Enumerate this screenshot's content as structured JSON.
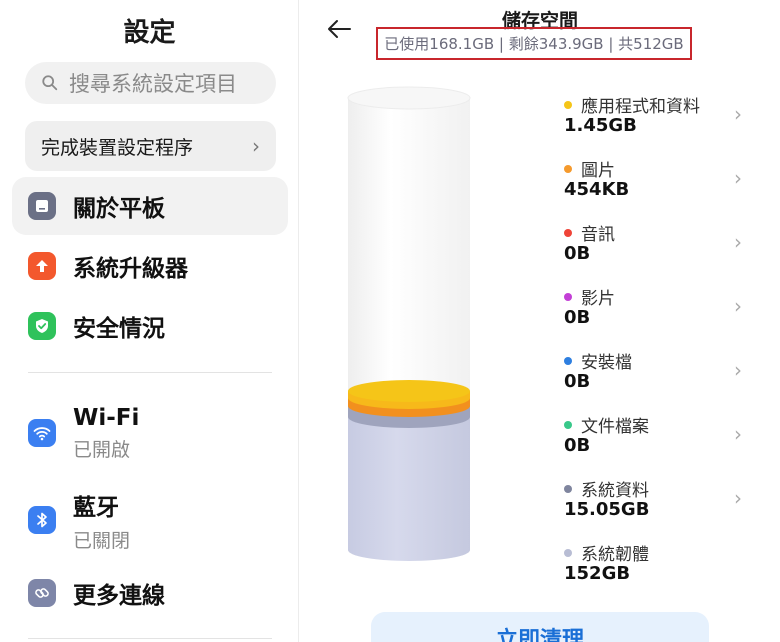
{
  "settings": {
    "title": "設定",
    "search_placeholder": "搜尋系統設定項目",
    "setup_card": {
      "label": "完成裝置設定程序"
    },
    "menu": [
      {
        "label": "關於平板",
        "icon": "tablet-icon",
        "color": "#6b7086"
      },
      {
        "label": "系統升級器",
        "icon": "arrow-up-icon",
        "color": "#f3582d"
      },
      {
        "label": "安全情況",
        "icon": "shield-check-icon",
        "color": "#2fc25b"
      },
      {
        "label": "Wi-Fi",
        "sub": "已開啟",
        "icon": "wifi-icon",
        "color": "#3b7ff1"
      },
      {
        "label": "藍牙",
        "sub": "已關閉",
        "icon": "bluetooth-icon",
        "color": "#3b7ff1"
      },
      {
        "label": "更多連線",
        "icon": "link-icon",
        "color": "#7e86a8"
      }
    ]
  },
  "storage": {
    "title": "儲存空間",
    "summary": "已使用168.1GB | 剩餘343.9GB | 共512GB",
    "used_gb": 168.1,
    "free_gb": 343.9,
    "total_gb": 512,
    "categories": [
      {
        "name": "應用程式和資料",
        "size": "1.45GB",
        "color": "#f5c518"
      },
      {
        "name": "圖片",
        "size": "454KB",
        "color": "#f59a2d"
      },
      {
        "name": "音訊",
        "size": "0B",
        "color": "#ef4438"
      },
      {
        "name": "影片",
        "size": "0B",
        "color": "#c33fd6"
      },
      {
        "name": "安裝檔",
        "size": "0B",
        "color": "#2e7fe0"
      },
      {
        "name": "文件檔案",
        "size": "0B",
        "color": "#39c88a"
      },
      {
        "name": "系統資料",
        "size": "15.05GB",
        "color": "#7f859e"
      },
      {
        "name": "系統韌體",
        "size": "152GB",
        "color": "#b8bdd4"
      }
    ],
    "clean_button": "立即清理"
  }
}
